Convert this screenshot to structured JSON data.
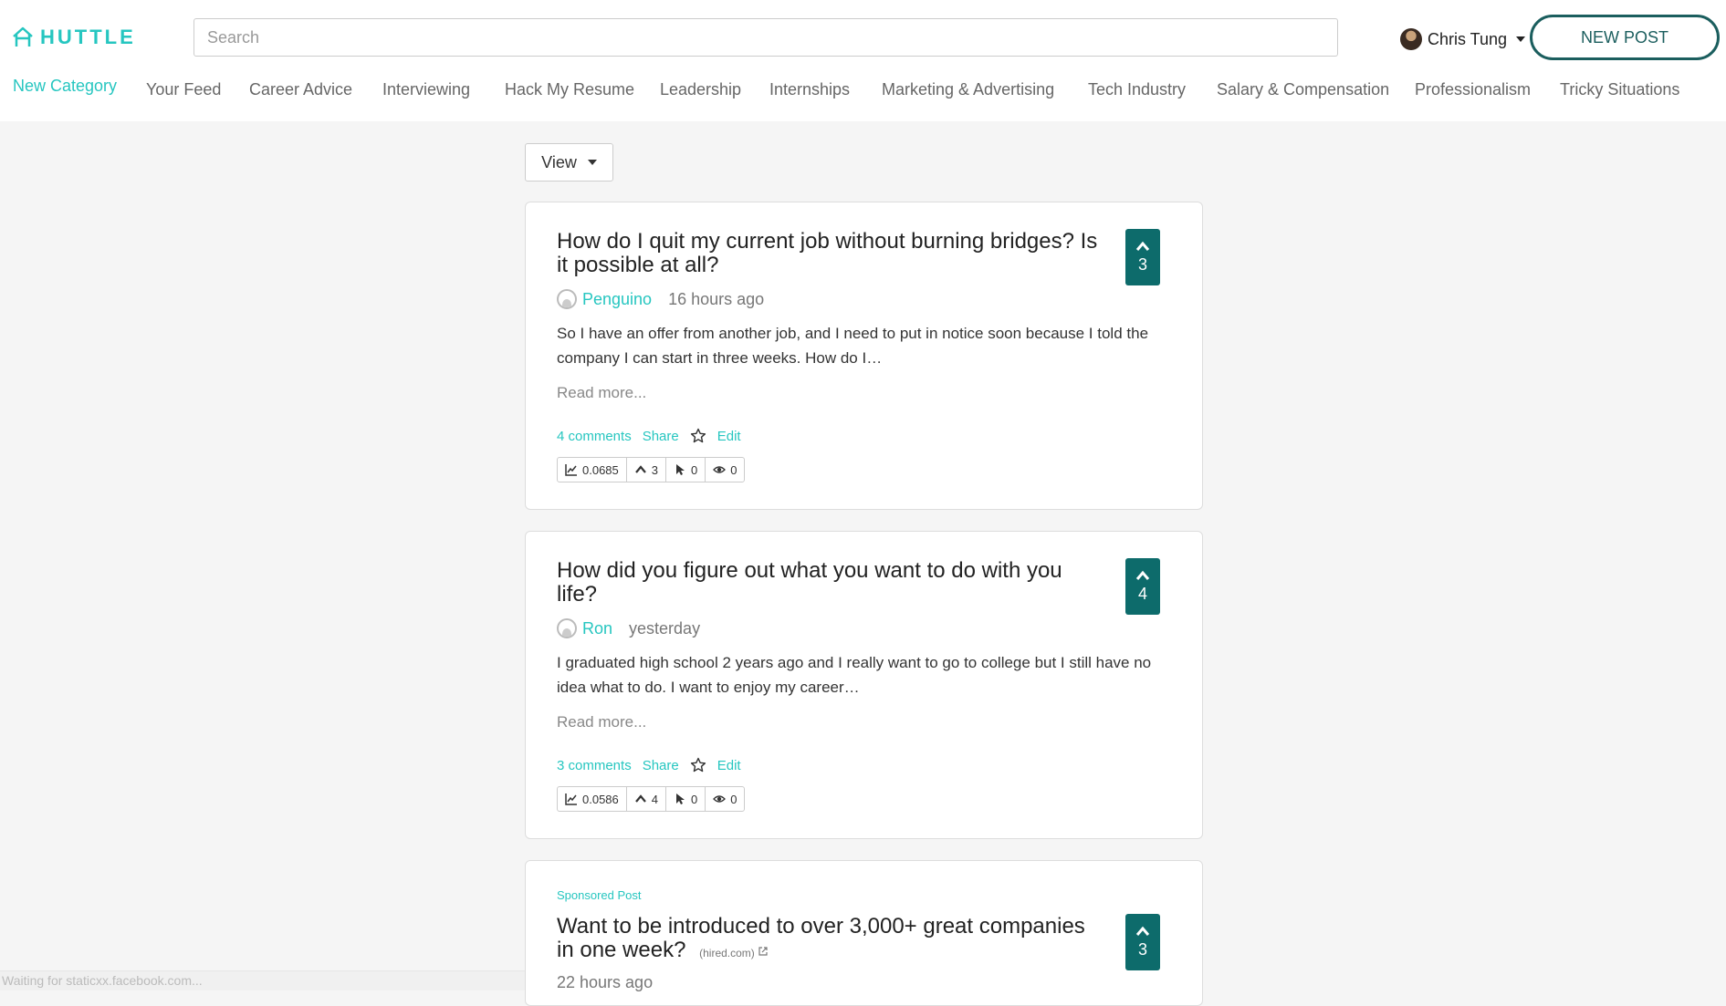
{
  "header": {
    "logo_text": "HUTTLE",
    "search_placeholder": "Search",
    "user_name": "Chris Tung",
    "new_post_label": "NEW POST"
  },
  "nav": {
    "items": [
      {
        "label": "New Category"
      },
      {
        "label": "Your Feed"
      },
      {
        "label": "Career Advice"
      },
      {
        "label": "Interviewing"
      },
      {
        "label": "Hack My Resume"
      },
      {
        "label": "Leadership"
      },
      {
        "label": "Internships"
      },
      {
        "label": "Marketing & Advertising"
      },
      {
        "label": "Tech Industry"
      },
      {
        "label": "Salary & Compensation"
      },
      {
        "label": "Professionalism"
      },
      {
        "label": "Tricky Situations"
      }
    ]
  },
  "view_label": "View",
  "posts": [
    {
      "title": "How do I quit my current job without burning bridges? Is it possible at all?",
      "author": "Penguino",
      "time": "16 hours ago",
      "excerpt": "So I have an offer from another job, and I need to put in notice soon because I told the company I can start in three weeks. How do I…",
      "read_more": "Read more...",
      "comments": "4 comments",
      "share": "Share",
      "edit": "Edit",
      "votes": "3",
      "stats": {
        "score": "0.0685",
        "upvotes": "3",
        "clicks": "0",
        "views": "0"
      }
    },
    {
      "title": "How did you figure out what you want to do with you life?",
      "author": "Ron",
      "time": "yesterday",
      "excerpt": "I graduated high school 2 years ago and I really want to go to college but I still have no idea what to do. I want to enjoy my career…",
      "read_more": "Read more...",
      "comments": "3 comments",
      "share": "Share",
      "edit": "Edit",
      "votes": "4",
      "stats": {
        "score": "0.0586",
        "upvotes": "4",
        "clicks": "0",
        "views": "0"
      }
    },
    {
      "sponsored_label": "Sponsored Post",
      "title": "Want to be introduced to over 3,000+ great companies in one week?",
      "source": "(hired.com)",
      "time": "22 hours ago",
      "votes": "3"
    }
  ],
  "status_text": "Waiting for staticxx.facebook.com...",
  "colors": {
    "accent": "#26c6c0",
    "vote_bg": "#0d6b6b",
    "new_post_border": "#1b5e5e"
  }
}
